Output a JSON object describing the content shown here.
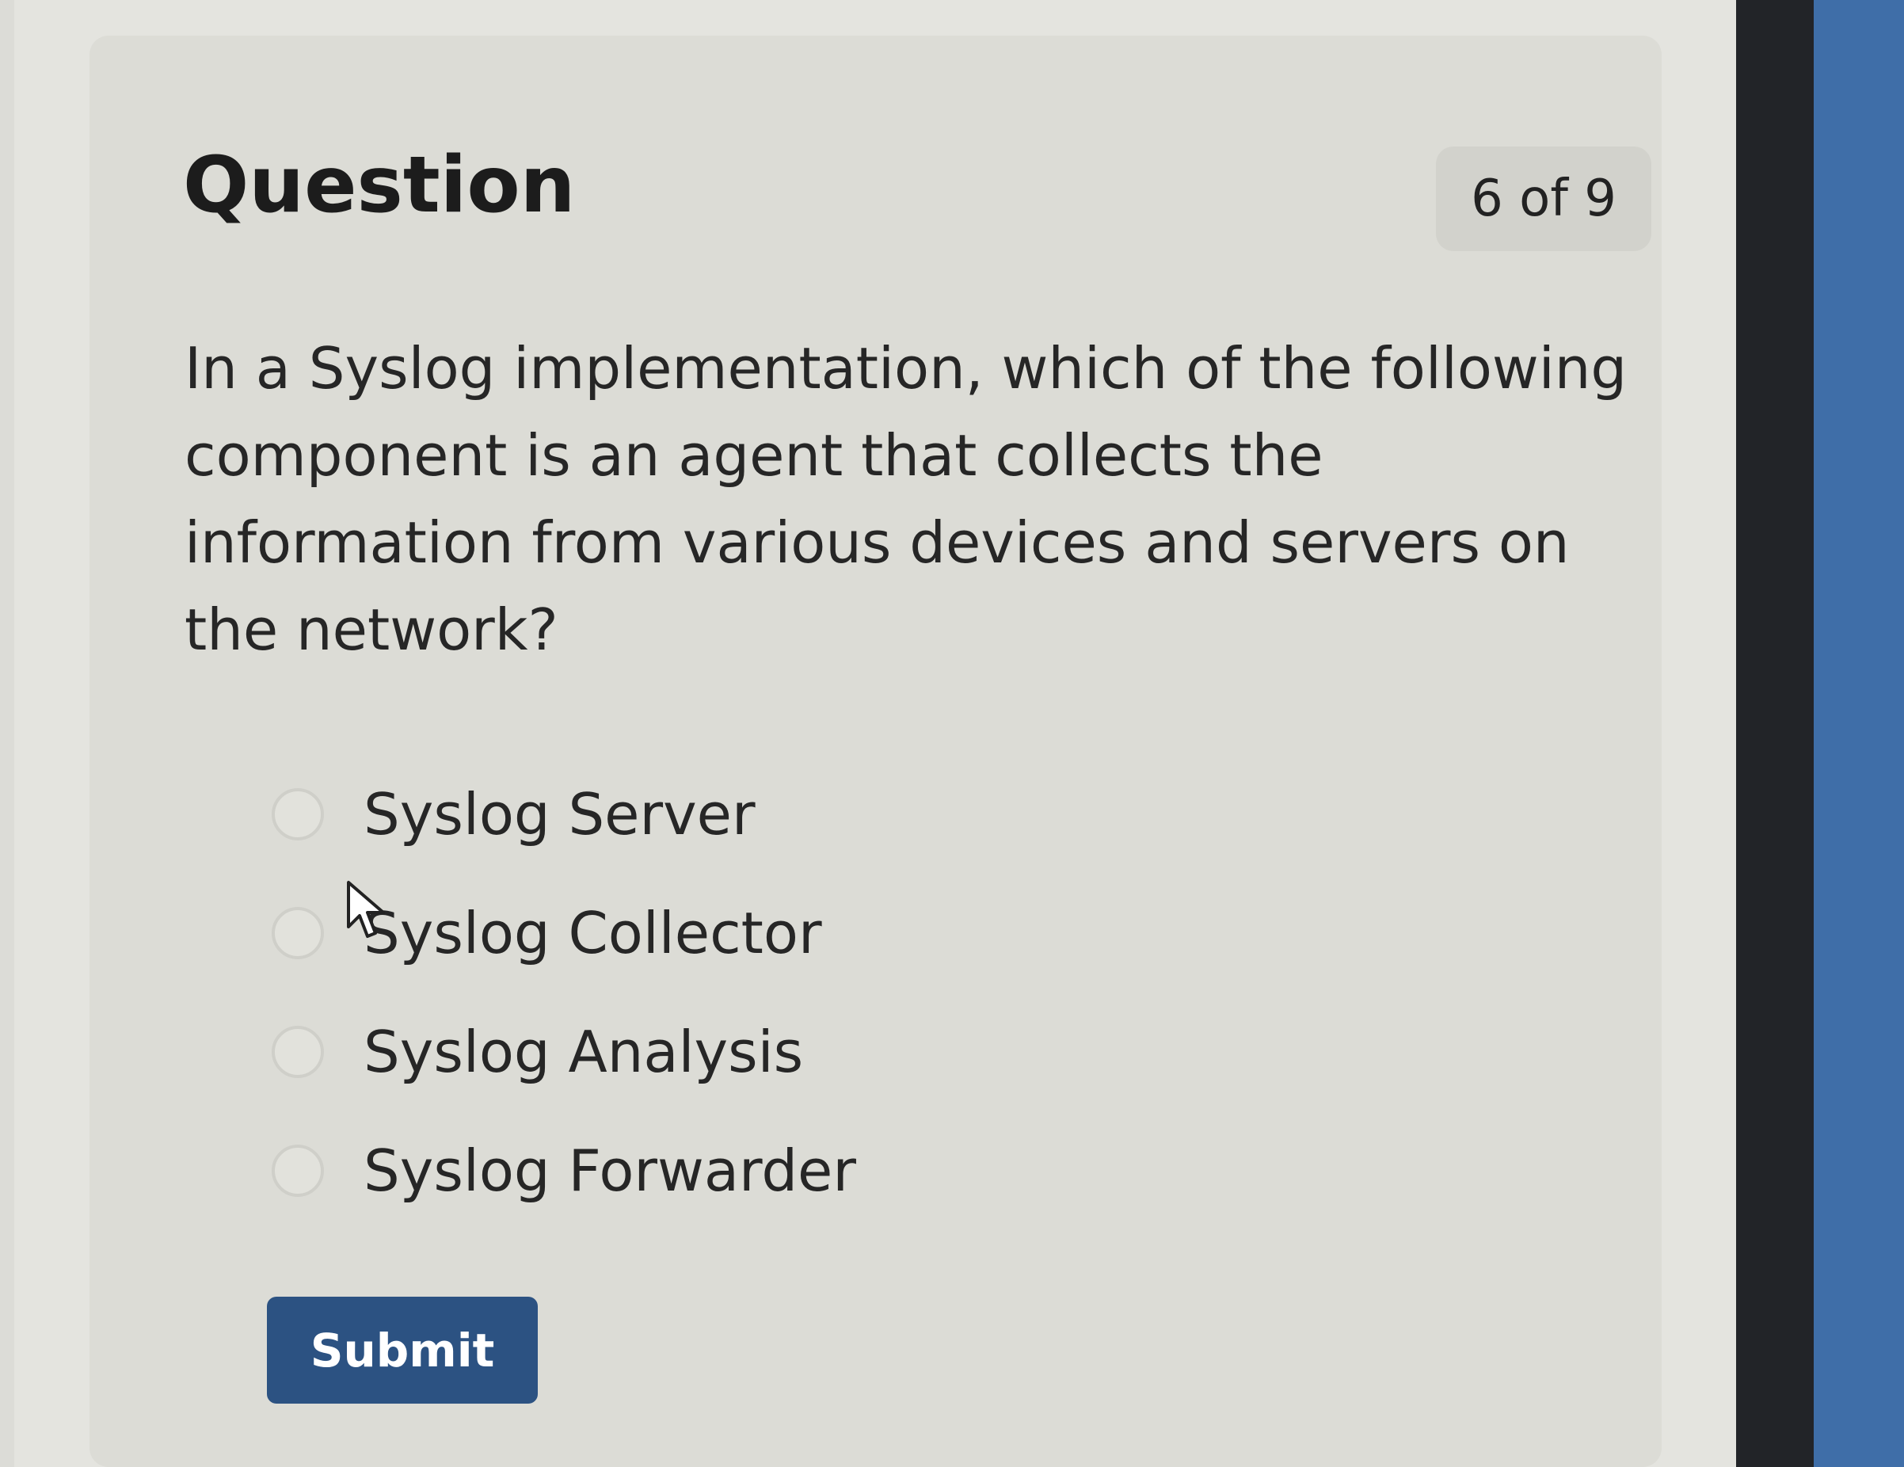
{
  "quiz": {
    "title": "Question",
    "progress": "6 of 9",
    "question_text": "In a Syslog implementation, which of the following component is an agent that collects the information from various devices and servers on the network?",
    "options": [
      {
        "label": "Syslog Server",
        "selected": false
      },
      {
        "label": "Syslog Collector",
        "selected": false
      },
      {
        "label": "Syslog Analysis",
        "selected": false
      },
      {
        "label": "Syslog Forwarder",
        "selected": false
      }
    ],
    "submit_label": "Submit"
  },
  "colors": {
    "accent": "#2c5282",
    "card_background": "#dcdcd6",
    "text": "#262626"
  },
  "icons": {
    "cursor": "mouse-pointer-icon"
  }
}
